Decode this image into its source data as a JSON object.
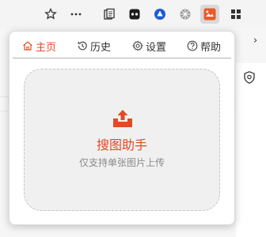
{
  "toolbar": {
    "icons": [
      "star-icon",
      "more-icon",
      "extension-icon",
      "extension-icon",
      "extension-icon",
      "extension-icon",
      "image-search-extension-icon",
      "extensions-grid-icon"
    ]
  },
  "background": {
    "chevron": "›"
  },
  "popup": {
    "tabs": [
      {
        "label": "主页",
        "icon": "home-icon"
      },
      {
        "label": "历史",
        "icon": "history-icon"
      },
      {
        "label": "设置",
        "icon": "settings-icon"
      },
      {
        "label": "帮助",
        "icon": "help-icon"
      }
    ],
    "dropzone": {
      "title": "搜图助手",
      "subtitle": "仅支持单张图片上传"
    }
  },
  "colors": {
    "accent": "#e24a26",
    "muted": "#8a8a8a"
  }
}
